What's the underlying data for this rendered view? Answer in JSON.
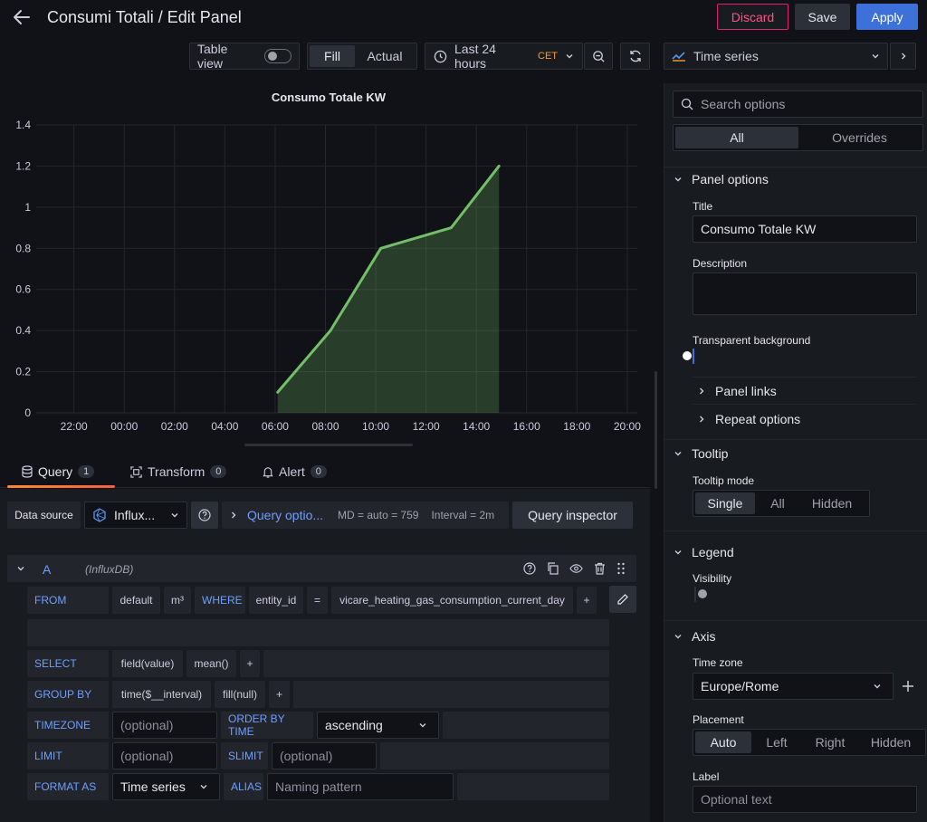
{
  "header": {
    "title": "Consumi Totali / Edit Panel",
    "discard_label": "Discard",
    "save_label": "Save",
    "apply_label": "Apply"
  },
  "toolbar": {
    "table_view_label": "Table view",
    "fill_label": "Fill",
    "actual_label": "Actual",
    "time_range_label": "Last 24 hours",
    "timezone_badge": "CET",
    "viz_label": "Time series"
  },
  "chart_data": {
    "type": "area",
    "title": "Consumo Totale KW",
    "x_ticks": [
      "22:00",
      "00:00",
      "02:00",
      "04:00",
      "06:00",
      "08:00",
      "10:00",
      "12:00",
      "14:00",
      "16:00",
      "18:00",
      "20:00"
    ],
    "y_ticks": [
      "0",
      "0.2",
      "0.4",
      "0.6",
      "0.8",
      "1",
      "1.2",
      "1.4"
    ],
    "ylim": [
      0,
      1.4
    ],
    "x_start_hour": 20.5,
    "x_end_hour": 44.4,
    "series": [
      {
        "color": "#73bf69",
        "points": [
          [
            30.1,
            0.1
          ],
          [
            32.2,
            0.4
          ],
          [
            34.2,
            0.8
          ],
          [
            37.0,
            0.9
          ],
          [
            38.9,
            1.2
          ]
        ]
      }
    ],
    "grid": true
  },
  "tabs": [
    {
      "label": "Query",
      "count": "1",
      "icon": "database-icon"
    },
    {
      "label": "Transform",
      "count": "0",
      "icon": "transform-icon"
    },
    {
      "label": "Alert",
      "count": "0",
      "icon": "bell-icon"
    }
  ],
  "datasource": {
    "label": "Data source",
    "value": "Influx...",
    "query_options_label": "Query optio...",
    "md_text": "MD = auto = 759",
    "interval_text": "Interval = 2m",
    "inspector_label": "Query inspector"
  },
  "query": {
    "ref_id": "A",
    "ds_name": "(InfluxDB)",
    "from_kw": "FROM",
    "from_policy": "default",
    "from_measurement": "m³",
    "where_kw": "WHERE",
    "where_key": "entity_id",
    "where_op": "=",
    "where_value": "vicare_heating_gas_consumption_current_day",
    "plus": "+",
    "select_kw": "SELECT",
    "select_field": "field(value)",
    "select_fn": "mean()",
    "groupby_kw": "GROUP BY",
    "groupby_time": "time($__interval)",
    "groupby_fill": "fill(null)",
    "timezone_kw": "TIMEZONE",
    "timezone_placeholder": "(optional)",
    "orderby_kw": "ORDER BY TIME",
    "orderby_value": "ascending",
    "limit_kw": "LIMIT",
    "limit_placeholder": "(optional)",
    "slimit_kw": "SLIMIT",
    "slimit_placeholder": "(optional)",
    "format_kw": "FORMAT AS",
    "format_value": "Time series",
    "alias_kw": "ALIAS",
    "alias_placeholder": "Naming pattern"
  },
  "options": {
    "search_placeholder": "Search options",
    "all_label": "All",
    "overrides_label": "Overrides",
    "panel_options": {
      "header": "Panel options",
      "title_label": "Title",
      "title_value": "Consumo Totale KW",
      "description_label": "Description",
      "transparent_label": "Transparent background",
      "panel_links_label": "Panel links",
      "repeat_options_label": "Repeat options"
    },
    "tooltip": {
      "header": "Tooltip",
      "mode_label": "Tooltip mode",
      "modes": [
        "Single",
        "All",
        "Hidden"
      ]
    },
    "legend": {
      "header": "Legend",
      "visibility_label": "Visibility"
    },
    "axis": {
      "header": "Axis",
      "timezone_label": "Time zone",
      "timezone_value": "Europe/Rome",
      "placement_label": "Placement",
      "placements": [
        "Auto",
        "Left",
        "Right",
        "Hidden"
      ],
      "label_label": "Label",
      "label_placeholder": "Optional text"
    }
  },
  "colors": {
    "accent": "#3d71d9",
    "series": "#73bf69",
    "danger": "#e0226e",
    "tab_underline": "#f55f3e"
  }
}
